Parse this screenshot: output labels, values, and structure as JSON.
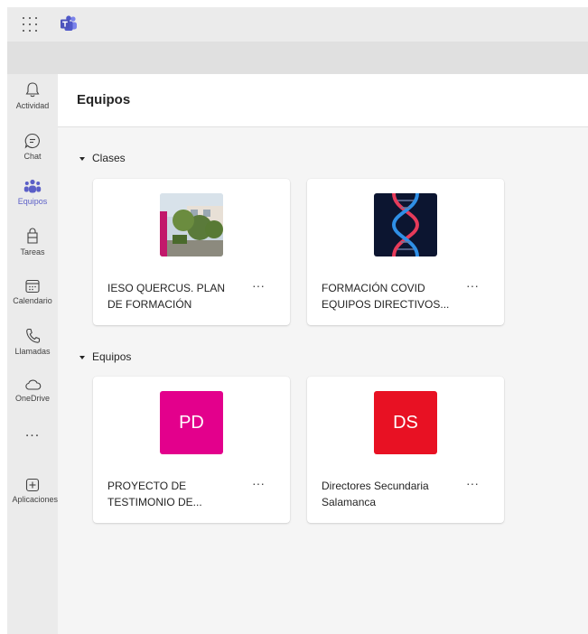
{
  "colors": {
    "accent": "#5b5fc7",
    "tile_pd": "#e3008c",
    "tile_ds": "#e81123"
  },
  "rail": {
    "items": [
      {
        "label": "Actividad",
        "icon": "bell-icon"
      },
      {
        "label": "Chat",
        "icon": "chat-icon"
      },
      {
        "label": "Equipos",
        "icon": "teams-icon",
        "active": true
      },
      {
        "label": "Tareas",
        "icon": "assignments-icon"
      },
      {
        "label": "Calendario",
        "icon": "calendar-icon"
      },
      {
        "label": "Llamadas",
        "icon": "phone-icon"
      },
      {
        "label": "OneDrive",
        "icon": "cloud-icon"
      },
      {
        "label": "...",
        "icon": "more-icon"
      },
      {
        "label": "Aplicaciones",
        "icon": "add-app-icon"
      }
    ]
  },
  "main": {
    "title": "Equipos",
    "sections": [
      {
        "label": "Clases",
        "cards": [
          {
            "title": "IESO QUERCUS. PLAN DE FORMACIÓN",
            "thumb": "school-photo",
            "more": "···"
          },
          {
            "title": "FORMACIÓN COVID EQUIPOS DIRECTIVOS...",
            "thumb": "dna-image",
            "more": "···"
          }
        ]
      },
      {
        "label": "Equipos",
        "cards": [
          {
            "title": "PROYECTO DE TESTIMONIO DE...",
            "initials": "PD",
            "more": "···"
          },
          {
            "title": "Directores Secundaria Salamanca",
            "initials": "DS",
            "more": "···"
          }
        ]
      }
    ]
  }
}
